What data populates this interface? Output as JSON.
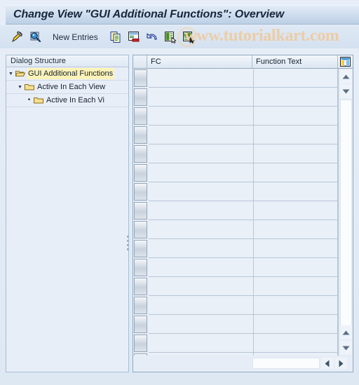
{
  "window": {
    "title": "Change View \"GUI Additional Functions\": Overview"
  },
  "watermark": {
    "text": "www.tutorialkart.com"
  },
  "toolbar": {
    "items": [
      {
        "icon": "pencil-display-change-icon",
        "label": ""
      },
      {
        "icon": "magnifier-details-icon",
        "label": ""
      },
      {
        "icon": "",
        "label": "New Entries"
      },
      {
        "icon": "copy-as-icon",
        "label": ""
      },
      {
        "icon": "delete-entry-icon",
        "label": ""
      },
      {
        "icon": "undo-change-icon",
        "label": ""
      },
      {
        "icon": "select-all-icon",
        "label": ""
      },
      {
        "icon": "deselect-all-icon",
        "label": ""
      }
    ],
    "new_entries_label": "New Entries"
  },
  "tree": {
    "header": "Dialog Structure",
    "items": [
      {
        "label": "GUI Additional Functions",
        "level": 0,
        "expanded": true,
        "selected": true,
        "icon": "open-folder-icon"
      },
      {
        "label": "Active In Each View",
        "level": 1,
        "expanded": true,
        "selected": false,
        "icon": "folder-icon"
      },
      {
        "label": "Active In Each Vi",
        "level": 2,
        "expanded": false,
        "selected": false,
        "icon": "folder-icon"
      }
    ]
  },
  "table": {
    "columns": [
      {
        "key": "fc",
        "label": "FC"
      },
      {
        "key": "function_text",
        "label": "Function Text"
      }
    ],
    "config_icon": "table-settings-icon",
    "rows": [
      {
        "fc": "",
        "function_text": ""
      },
      {
        "fc": "",
        "function_text": ""
      },
      {
        "fc": "",
        "function_text": ""
      },
      {
        "fc": "",
        "function_text": ""
      },
      {
        "fc": "",
        "function_text": ""
      },
      {
        "fc": "",
        "function_text": ""
      },
      {
        "fc": "",
        "function_text": ""
      },
      {
        "fc": "",
        "function_text": ""
      },
      {
        "fc": "",
        "function_text": ""
      },
      {
        "fc": "",
        "function_text": ""
      },
      {
        "fc": "",
        "function_text": ""
      },
      {
        "fc": "",
        "function_text": ""
      },
      {
        "fc": "",
        "function_text": ""
      },
      {
        "fc": "",
        "function_text": ""
      },
      {
        "fc": "",
        "function_text": ""
      },
      {
        "fc": "",
        "function_text": ""
      }
    ]
  },
  "colors": {
    "title_bar_start": "#e3ecf7",
    "title_bar_end": "#bdd0e6",
    "selection_highlight": "#fdf3b8",
    "watermark": "#eccda6",
    "grid_line": "#b6c6d6",
    "panel_bg": "#e9eff7"
  }
}
